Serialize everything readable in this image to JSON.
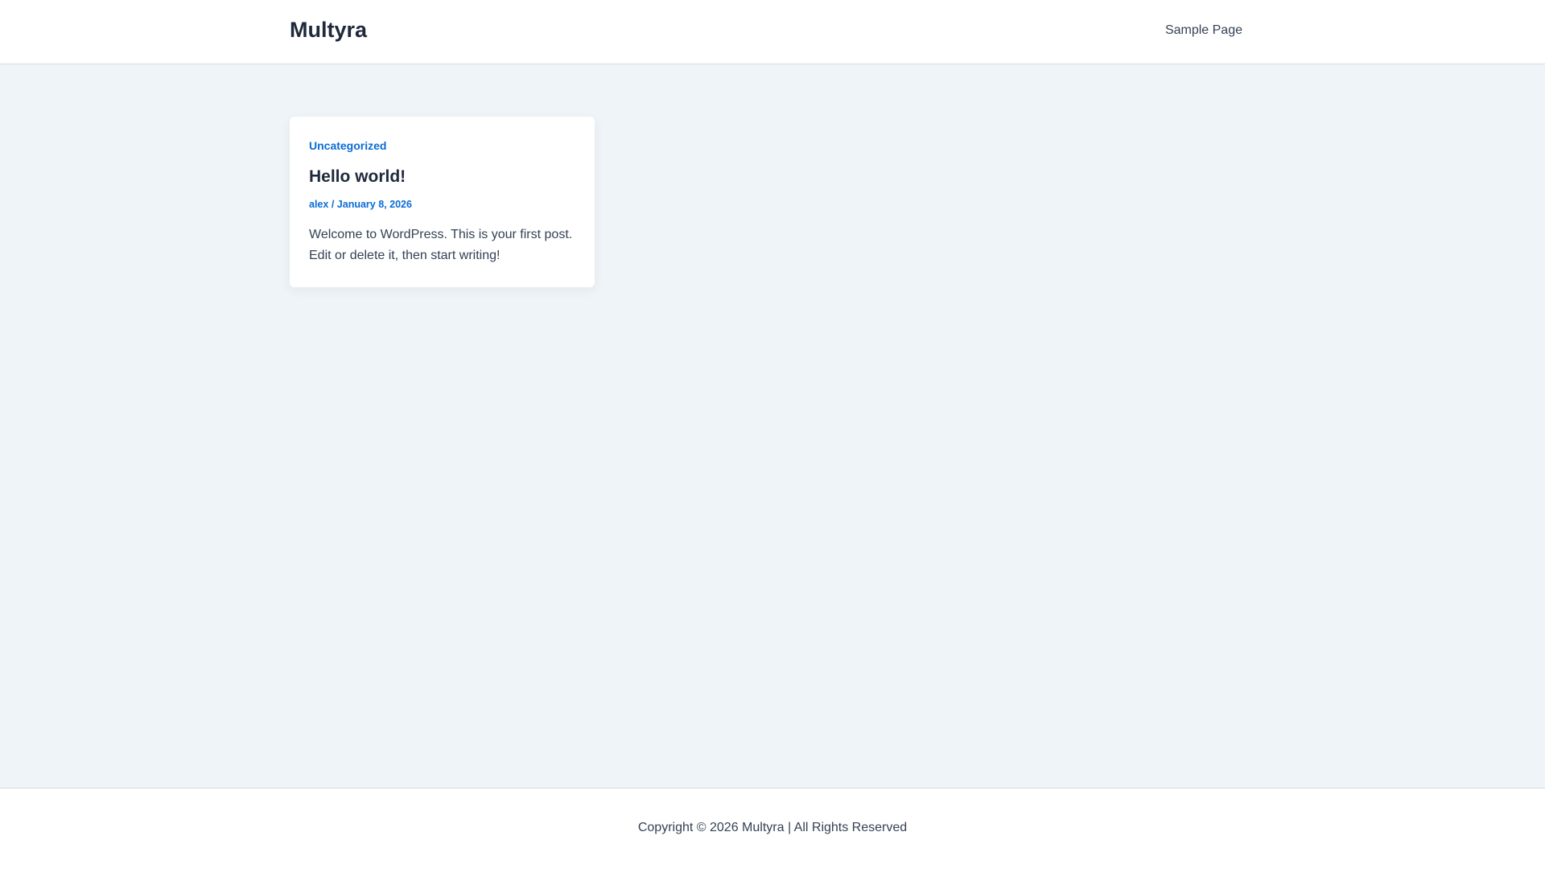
{
  "header": {
    "site_title": "Multyra",
    "nav": [
      {
        "label": "Sample Page"
      }
    ]
  },
  "post": {
    "category": "Uncategorized",
    "title": "Hello world!",
    "author": "alex",
    "separator": "/",
    "date": "January 8, 2026",
    "excerpt": "Welcome to WordPress. This is your first post. Edit or delete it, then start writing!"
  },
  "footer": {
    "copyright": "Copyright © 2026 Multyra | All Rights Reserved"
  },
  "colors": {
    "accent": "#0a6bd6",
    "background": "#eff4f8",
    "text": "#1e293b"
  }
}
